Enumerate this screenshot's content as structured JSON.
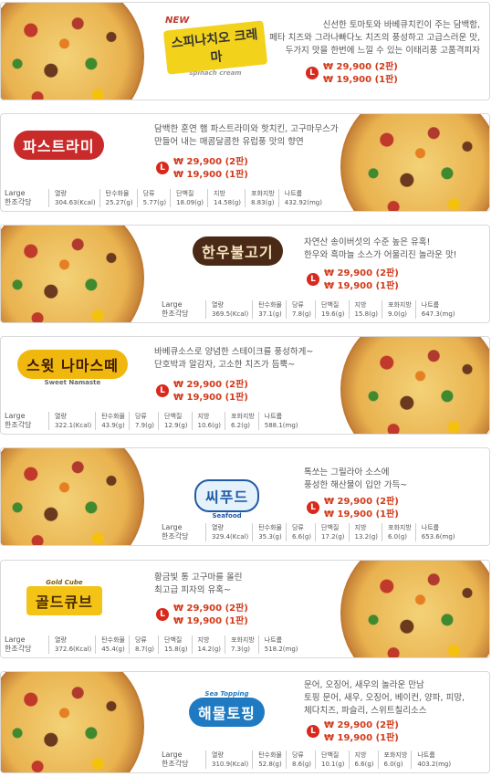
{
  "cards": [
    {
      "logo": "스피나치오 크레마",
      "logo_top": "NEW",
      "logo_sub": "spinach cream",
      "desc": [
        "신선한 토마토와 바베큐치킨이 주는 담백함,",
        "페타 치즈와 그라나빠다노 치즈의 풍성하고 고급스러운 맛,",
        "두가지 맛을 한번에 느낄 수 있는 이태리풍 고품격피자"
      ],
      "price1": "₩ 29,900 (2판)",
      "price2": "₩ 19,900 (1판)"
    },
    {
      "logo": "파스트라미",
      "desc": [
        "담백한 훈연 햄 파스트라미와 핫치킨, 고구마무스가",
        "만들어 내는 매콤달콤한 유럽풍 맛의 향연"
      ],
      "price1": "₩ 29,900 (2판)",
      "price2": "₩ 19,900 (1판)",
      "size": [
        "Large",
        "한조각당"
      ],
      "nutrition": [
        {
          "label": "열량",
          "value": "304.63(Kcal)"
        },
        {
          "label": "탄수화물",
          "value": "25.27(g)"
        },
        {
          "label": "당류",
          "value": "5.77(g)"
        },
        {
          "label": "단백질",
          "value": "18.09(g)"
        },
        {
          "label": "지방",
          "value": "14.58(g)"
        },
        {
          "label": "포화지방",
          "value": "8.83(g)"
        },
        {
          "label": "나트륨",
          "value": "432.92(mg)"
        }
      ]
    },
    {
      "logo": "한우불고기",
      "desc": [
        "자연산 송이버섯의 수준 높은 유혹!",
        "한우와 흑마늘 소스가 어울리진 놀라운 맛!"
      ],
      "price1": "₩ 29,900 (2판)",
      "price2": "₩ 19,900 (1판)",
      "size": [
        "Large",
        "한조각당"
      ],
      "nutrition": [
        {
          "label": "열량",
          "value": "369.5(Kcal)"
        },
        {
          "label": "탄수화물",
          "value": "37.1(g)"
        },
        {
          "label": "당류",
          "value": "7.8(g)"
        },
        {
          "label": "단백질",
          "value": "19.6(g)"
        },
        {
          "label": "지방",
          "value": "15.8(g)"
        },
        {
          "label": "포화지방",
          "value": "9.0(g)"
        },
        {
          "label": "나트륨",
          "value": "647.3(mg)"
        }
      ]
    },
    {
      "logo": "스윗 나마스떼",
      "logo_sub": "Sweet Namaste",
      "desc": [
        "바베큐소스로 양념한 스테이크를 풍성하게~",
        "단호박과 알감자, 고소한 치즈가 듬뿍~"
      ],
      "price1": "₩ 29,900 (2판)",
      "price2": "₩ 19,900 (1판)",
      "size": [
        "Large",
        "한조각당"
      ],
      "nutrition": [
        {
          "label": "열량",
          "value": "322.1(Kcal)"
        },
        {
          "label": "탄수화물",
          "value": "43.9(g)"
        },
        {
          "label": "당류",
          "value": "7.9(g)"
        },
        {
          "label": "단백질",
          "value": "12.9(g)"
        },
        {
          "label": "지방",
          "value": "10.6(g)"
        },
        {
          "label": "포화지방",
          "value": "6.2(g)"
        },
        {
          "label": "나트륨",
          "value": "588.1(mg)"
        }
      ]
    },
    {
      "logo": "씨푸드",
      "logo_sub": "Seafood",
      "desc": [
        "톡쏘는 그릴라아 소스에",
        "풍성한 해산물이 입안 가득~"
      ],
      "price1": "₩ 29,900 (2판)",
      "price2": "₩ 19,900 (1판)",
      "size": [
        "Large",
        "한조각당"
      ],
      "nutrition": [
        {
          "label": "열량",
          "value": "329.4(Kcal)"
        },
        {
          "label": "탄수화물",
          "value": "35.3(g)"
        },
        {
          "label": "당류",
          "value": "6.6(g)"
        },
        {
          "label": "단백질",
          "value": "17.2(g)"
        },
        {
          "label": "지방",
          "value": "13.2(g)"
        },
        {
          "label": "포화지방",
          "value": "6.0(g)"
        },
        {
          "label": "나트륨",
          "value": "653.6(mg)"
        }
      ]
    },
    {
      "logo": "골드큐브",
      "logo_sub": "Gold Cube",
      "desc": [
        "황금빛 통 고구마를 올린",
        "최고급 피자의 유혹~"
      ],
      "price1": "₩ 29,900 (2판)",
      "price2": "₩ 19,900 (1판)",
      "size": [
        "Large",
        "한조각당"
      ],
      "nutrition": [
        {
          "label": "열량",
          "value": "372.6(Kcal)"
        },
        {
          "label": "탄수화물",
          "value": "45.4(g)"
        },
        {
          "label": "당류",
          "value": "8.7(g)"
        },
        {
          "label": "단백질",
          "value": "15.8(g)"
        },
        {
          "label": "지방",
          "value": "14.2(g)"
        },
        {
          "label": "포화지방",
          "value": "7.3(g)"
        },
        {
          "label": "나트륨",
          "value": "518.2(mg)"
        }
      ]
    },
    {
      "logo": "해물토핑",
      "logo_sub": "Sea Topping",
      "desc": [
        "문어, 오징어, 새우의 놀라운 만남",
        "토핑 문어, 새우, 오징어, 베이컨, 양파, 피망,",
        "체다치즈, 파슬리, 스위트칠리소스"
      ],
      "price1": "₩ 29,900 (2판)",
      "price2": "₩ 19,900 (1판)",
      "size": [
        "Large",
        "한조각당"
      ],
      "nutrition": [
        {
          "label": "열량",
          "value": "310.9(Kcal)"
        },
        {
          "label": "탄수화물",
          "value": "52.8(g)"
        },
        {
          "label": "당류",
          "value": "8.6(g)"
        },
        {
          "label": "단백질",
          "value": "10.1(g)"
        },
        {
          "label": "지방",
          "value": "6.6(g)"
        },
        {
          "label": "포화지방",
          "value": "6.0(g)"
        },
        {
          "label": "나트륨",
          "value": "403.2(mg)"
        }
      ]
    }
  ],
  "badge_letter": "L"
}
